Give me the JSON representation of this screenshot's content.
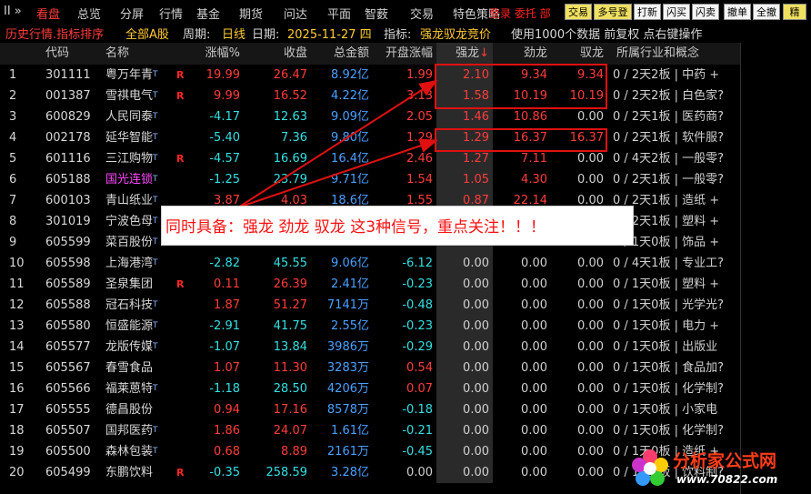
{
  "menu": {
    "expand": "II »",
    "items": [
      "看盘",
      "总览",
      "分屏",
      "行情",
      "基金",
      "期货",
      "问达",
      "平面",
      "智薮",
      "交易",
      "特色策略"
    ],
    "overlay_text": "登录 委托 部",
    "buttons": [
      "交易",
      "多号登",
      "打新",
      "闪买",
      "闪卖",
      "撤单",
      "全撤",
      "精"
    ]
  },
  "info": {
    "mode": "历史行情.指标排序",
    "market": "全部A股",
    "period_label": "周期:",
    "period_value": "日线",
    "date_label": "日期:",
    "date_value": "2025-11-27 四",
    "indicator_label": "指标:",
    "indicator_value": "强龙驭龙竞价",
    "hint": "使用1000个数据 前复权 点右键操作"
  },
  "columns": [
    "代码",
    "名称",
    "涨幅%",
    "收盘",
    "总金额",
    "开盘涨幅",
    "强龙",
    "劲龙",
    "驭龙",
    "所属行业和概念"
  ],
  "sort_arrow": "↓",
  "rows": [
    {
      "idx": "1",
      "code": "301111",
      "name": "粤万年青",
      "t": "T",
      "r": "R",
      "chg": "19.99",
      "close": "26.47",
      "amount": "8.92亿",
      "open": "1.99",
      "qiang": "2.10",
      "jin": "9.34",
      "yu": "9.34",
      "ind": "0 / 2天2板 | 中药 +"
    },
    {
      "idx": "2",
      "code": "001387",
      "name": "雪祺电气",
      "t": "T",
      "r": "R",
      "chg": "9.99",
      "close": "16.52",
      "amount": "4.22亿",
      "open": "3.13",
      "qiang": "1.58",
      "jin": "10.19",
      "yu": "10.19",
      "ind": "0 / 2天2板 | 白色家?"
    },
    {
      "idx": "3",
      "code": "600829",
      "name": "人民同泰",
      "t": "T",
      "r": "",
      "chg": "-4.17",
      "close": "12.63",
      "amount": "9.09亿",
      "open": "2.05",
      "qiang": "1.46",
      "jin": "10.86",
      "yu": "0.00",
      "ind": "0 / 2天1板 | 医药商?"
    },
    {
      "idx": "4",
      "code": "002178",
      "name": "延华智能",
      "t": "T",
      "r": "",
      "chg": "-5.40",
      "close": "7.36",
      "amount": "9.80亿",
      "open": "1.29",
      "qiang": "1.29",
      "jin": "16.37",
      "yu": "16.37",
      "ind": "0 / 2天1板 | 软件服?"
    },
    {
      "idx": "5",
      "code": "601116",
      "name": "三江购物",
      "t": "T",
      "r": "R",
      "chg": "-4.57",
      "close": "16.69",
      "amount": "16.4亿",
      "open": "2.46",
      "qiang": "1.27",
      "jin": "7.11",
      "yu": "0.00",
      "ind": "0 / 4天2板 | 一般零?"
    },
    {
      "idx": "6",
      "code": "605188",
      "name": "国光连锁",
      "t": "T",
      "r": "",
      "chg": "-1.25",
      "close": "23.79",
      "amount": "9.71亿",
      "open": "1.54",
      "qiang": "1.05",
      "jin": "4.30",
      "yu": "0.00",
      "ind": "0 / 2天1板 | 一般零?",
      "special": true
    },
    {
      "idx": "7",
      "code": "600103",
      "name": "青山纸业",
      "t": "T",
      "r": "",
      "chg": "3.87",
      "close": "4.03",
      "amount": "18.6亿",
      "open": "1.55",
      "qiang": "0.87",
      "jin": "22.14",
      "yu": "0.00",
      "ind": "0 / 2天1板 | 造纸 +"
    },
    {
      "idx": "8",
      "code": "301019",
      "name": "宁波色母",
      "t": "T",
      "r": "",
      "chg": "",
      "close": "",
      "amount": "",
      "open": "",
      "qiang": "",
      "jin": "",
      "yu": "",
      "ind": "0 / 2天1板 | 塑料 +"
    },
    {
      "idx": "9",
      "code": "605599",
      "name": "菜百股份",
      "t": "T",
      "r": "",
      "chg": "",
      "close": "",
      "amount": "",
      "open": "",
      "qiang": "",
      "jin": "",
      "yu": "",
      "ind": "0 / 1天0板 | 饰品 +"
    },
    {
      "idx": "10",
      "code": "605598",
      "name": "上海港湾",
      "t": "T",
      "r": "",
      "chg": "-2.82",
      "close": "45.55",
      "amount": "9.06亿",
      "open": "-6.12",
      "qiang": "0.00",
      "jin": "0.00",
      "yu": "0.00",
      "ind": "0 / 4天1板 | 专业工?"
    },
    {
      "idx": "11",
      "code": "605589",
      "name": "圣泉集团",
      "t": "",
      "r": "R",
      "chg": "0.11",
      "close": "26.39",
      "amount": "2.41亿",
      "open": "-0.23",
      "qiang": "0.00",
      "jin": "0.00",
      "yu": "0.00",
      "ind": "0 / 1天0板 | 塑料 +"
    },
    {
      "idx": "12",
      "code": "605588",
      "name": "冠石科技",
      "t": "T",
      "r": "",
      "chg": "1.87",
      "close": "51.27",
      "amount": "7141万",
      "open": "-0.48",
      "qiang": "0.00",
      "jin": "0.00",
      "yu": "0.00",
      "ind": "0 / 1天0板 | 光学光?"
    },
    {
      "idx": "13",
      "code": "605580",
      "name": "恒盛能源",
      "t": "T",
      "r": "",
      "chg": "-2.91",
      "close": "41.75",
      "amount": "2.55亿",
      "open": "-0.23",
      "qiang": "0.00",
      "jin": "0.00",
      "yu": "0.00",
      "ind": "0 / 1天0板 | 电力 +"
    },
    {
      "idx": "14",
      "code": "605577",
      "name": "龙版传媒",
      "t": "T",
      "r": "",
      "chg": "-1.07",
      "close": "13.84",
      "amount": "3986万",
      "open": "-0.29",
      "qiang": "0.00",
      "jin": "0.00",
      "yu": "0.00",
      "ind": "0 / 1天0板 | 出版业"
    },
    {
      "idx": "15",
      "code": "605567",
      "name": "春雪食品",
      "t": "",
      "r": "",
      "chg": "1.07",
      "close": "11.30",
      "amount": "3283万",
      "open": "0.54",
      "qiang": "0.00",
      "jin": "0.00",
      "yu": "0.00",
      "ind": "0 / 1天0板 | 食品加?"
    },
    {
      "idx": "16",
      "code": "605566",
      "name": "福莱蒽特",
      "t": "T",
      "r": "",
      "chg": "-1.18",
      "close": "28.50",
      "amount": "4206万",
      "open": "0.07",
      "qiang": "0.00",
      "jin": "0.00",
      "yu": "0.00",
      "ind": "0 / 1天0板 | 化学制?"
    },
    {
      "idx": "17",
      "code": "605555",
      "name": "德昌股份",
      "t": "",
      "r": "",
      "chg": "0.94",
      "close": "17.16",
      "amount": "8578万",
      "open": "-0.18",
      "qiang": "0.00",
      "jin": "0.00",
      "yu": "0.00",
      "ind": "0 / 1天0板 | 小家电"
    },
    {
      "idx": "18",
      "code": "605507",
      "name": "国邦医药",
      "t": "T",
      "r": "",
      "chg": "1.86",
      "close": "24.07",
      "amount": "1.61亿",
      "open": "-0.21",
      "qiang": "0.00",
      "jin": "0.00",
      "yu": "0.00",
      "ind": "0 / 1天0板 | 化学制?"
    },
    {
      "idx": "19",
      "code": "605500",
      "name": "森林包装",
      "t": "T",
      "r": "",
      "chg": "0.68",
      "close": "8.89",
      "amount": "2161万",
      "open": "-0.45",
      "qiang": "0.00",
      "jin": "0.00",
      "yu": "0.00",
      "ind": "0 / 1天0板 | 造纸 +"
    },
    {
      "idx": "20",
      "code": "605499",
      "name": "东鹏饮料",
      "t": "",
      "r": "R",
      "chg": "-0.35",
      "close": "258.59",
      "amount": "3.28亿",
      "open": "0.00",
      "qiang": "0.00",
      "jin": "0.00",
      "yu": "0.00",
      "ind": "0 / 1天0板 | 饮料制?"
    }
  ],
  "annotation": "同时具备：强龙 劲龙 驭龙 这3种信号，重点关注！！！",
  "watermark": {
    "title": "分析家公式网",
    "url": "www.70822.com"
  },
  "colors": {
    "up": "#ff3c3c",
    "down": "#33e0e0",
    "amount": "#4aa0ff",
    "highlight_box": "#e01010",
    "annotation_text": "#ff1010",
    "special_name": "#ff48ff"
  }
}
